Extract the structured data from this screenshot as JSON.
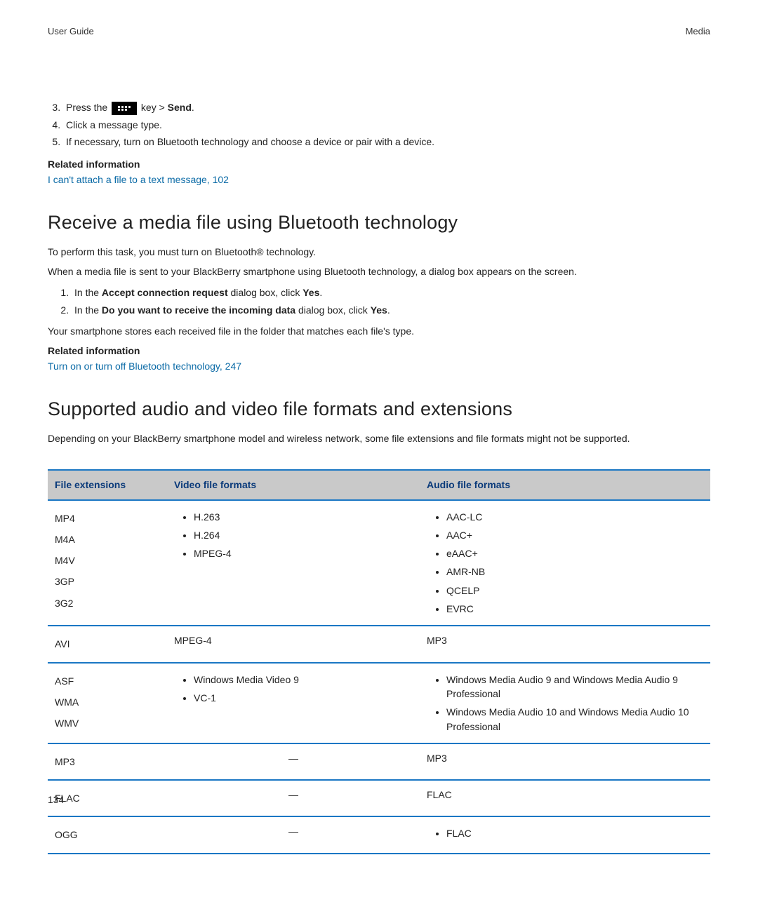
{
  "header": {
    "left": "User Guide",
    "right": "Media"
  },
  "steps_top": {
    "start": 3,
    "items": [
      {
        "pre": "Press the ",
        "post": " key > ",
        "bold": "Send",
        "tail": "."
      },
      {
        "text": "Click a message type."
      },
      {
        "text": "If necessary, turn on Bluetooth technology and choose a device or pair with a device."
      }
    ]
  },
  "related1": {
    "heading": "Related information",
    "link": "I can't attach a file to a text message, 102"
  },
  "section1": {
    "title": "Receive a media file using Bluetooth technology",
    "p1": "To perform this task, you must turn on Bluetooth® technology.",
    "p2": "When a media file is sent to your BlackBerry smartphone using Bluetooth technology, a dialog box appears on the screen.",
    "steps": [
      {
        "a": "In the ",
        "b": "Accept connection request",
        "c": " dialog box, click ",
        "d": "Yes",
        "e": "."
      },
      {
        "a": "In the ",
        "b": "Do you want to receive the incoming data",
        "c": " dialog box, click ",
        "d": "Yes",
        "e": "."
      }
    ],
    "p3": "Your smartphone stores each received file in the folder that matches each file's type."
  },
  "related2": {
    "heading": "Related information",
    "link": "Turn on or turn off Bluetooth technology, 247"
  },
  "section2": {
    "title": "Supported audio and video file formats and extensions",
    "desc": "Depending on your BlackBerry smartphone model and wireless network, some file extensions and file formats might not be supported."
  },
  "table": {
    "headers": {
      "ext": "File extensions",
      "vid": "Video file formats",
      "aud": "Audio file formats"
    },
    "rows": [
      {
        "ext": [
          "MP4",
          "M4A",
          "M4V",
          "3GP",
          "3G2"
        ],
        "vid_bullets": [
          "H.263",
          "H.264",
          "MPEG-4"
        ],
        "aud_bullets": [
          "AAC-LC",
          "AAC+",
          "eAAC+",
          "AMR-NB",
          "QCELP",
          "EVRC"
        ]
      },
      {
        "ext": [
          "AVI"
        ],
        "vid_text": "MPEG-4",
        "aud_text": "MP3"
      },
      {
        "ext": [
          "ASF",
          "WMA",
          "WMV"
        ],
        "vid_bullets": [
          "Windows Media Video 9",
          "VC-1"
        ],
        "aud_bullets": [
          "Windows Media Audio 9 and Windows Media Audio 9 Professional",
          "Windows Media Audio 10 and Windows Media Audio 10 Professional"
        ]
      },
      {
        "ext": [
          "MP3"
        ],
        "vid_dash": "—",
        "aud_text": "MP3"
      },
      {
        "ext": [
          "FLAC"
        ],
        "vid_dash": "—",
        "aud_text": "FLAC"
      },
      {
        "ext": [
          "OGG"
        ],
        "vid_dash": "—",
        "aud_bullets": [
          "FLAC"
        ]
      }
    ]
  },
  "chart_data": {
    "type": "table",
    "title": "Supported audio and video file formats and extensions",
    "columns": [
      "File extensions",
      "Video file formats",
      "Audio file formats"
    ],
    "rows": [
      {
        "File extensions": [
          "MP4",
          "M4A",
          "M4V",
          "3GP",
          "3G2"
        ],
        "Video file formats": [
          "H.263",
          "H.264",
          "MPEG-4"
        ],
        "Audio file formats": [
          "AAC-LC",
          "AAC+",
          "eAAC+",
          "AMR-NB",
          "QCELP",
          "EVRC"
        ]
      },
      {
        "File extensions": [
          "AVI"
        ],
        "Video file formats": [
          "MPEG-4"
        ],
        "Audio file formats": [
          "MP3"
        ]
      },
      {
        "File extensions": [
          "ASF",
          "WMA",
          "WMV"
        ],
        "Video file formats": [
          "Windows Media Video 9",
          "VC-1"
        ],
        "Audio file formats": [
          "Windows Media Audio 9 and Windows Media Audio 9 Professional",
          "Windows Media Audio 10 and Windows Media Audio 10 Professional"
        ]
      },
      {
        "File extensions": [
          "MP3"
        ],
        "Video file formats": [],
        "Audio file formats": [
          "MP3"
        ]
      },
      {
        "File extensions": [
          "FLAC"
        ],
        "Video file formats": [],
        "Audio file formats": [
          "FLAC"
        ]
      },
      {
        "File extensions": [
          "OGG"
        ],
        "Video file formats": [],
        "Audio file formats": [
          "FLAC"
        ]
      }
    ]
  },
  "page_number": "134"
}
